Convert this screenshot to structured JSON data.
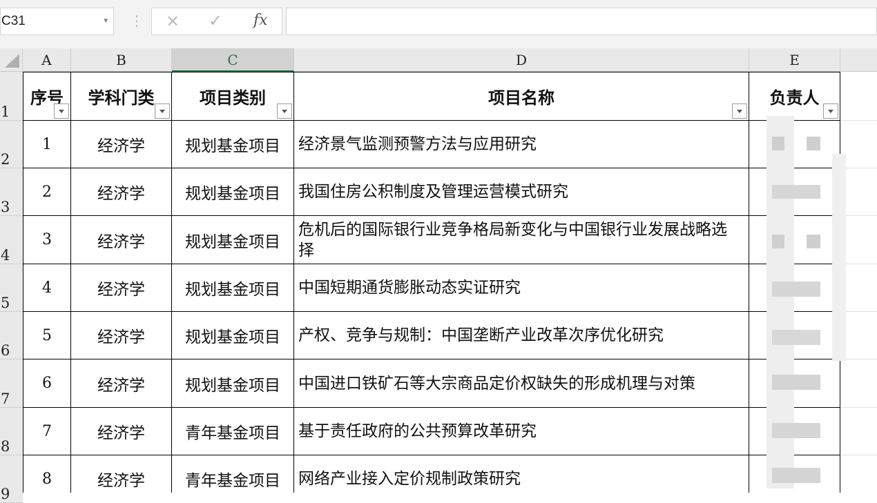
{
  "formula_bar": {
    "name_box": "C31",
    "cancel_icon": "×",
    "enter_icon": "✓",
    "fx_label": "fx",
    "formula": ""
  },
  "columns": [
    {
      "id": "A",
      "label": "A"
    },
    {
      "id": "B",
      "label": "B"
    },
    {
      "id": "C",
      "label": "C",
      "selected": true
    },
    {
      "id": "D",
      "label": "D"
    },
    {
      "id": "E",
      "label": "E"
    }
  ],
  "row_numbers": [
    "1",
    "2",
    "3",
    "4",
    "5",
    "6",
    "7",
    "8",
    "9"
  ],
  "table": {
    "headers": [
      "序号",
      "学科门类",
      "项目类别",
      "项目名称",
      "负责人"
    ],
    "rows": [
      {
        "no": "1",
        "subject": "经济学",
        "category": "规划基金项目",
        "name": "经济景气监测预警方法与应用研究"
      },
      {
        "no": "2",
        "subject": "经济学",
        "category": "规划基金项目",
        "name": "我国住房公积制度及管理运营模式研究"
      },
      {
        "no": "3",
        "subject": "经济学",
        "category": "规划基金项目",
        "name": "危机后的国际银行业竞争格局新变化与中国银行业发展战略选择"
      },
      {
        "no": "4",
        "subject": "经济学",
        "category": "规划基金项目",
        "name": "中国短期通货膨胀动态实证研究"
      },
      {
        "no": "5",
        "subject": "经济学",
        "category": "规划基金项目",
        "name": "产权、竞争与规制：中国垄断产业改革次序优化研究"
      },
      {
        "no": "6",
        "subject": "经济学",
        "category": "规划基金项目",
        "name": "中国进口铁矿石等大宗商品定价权缺失的形成机理与对策"
      },
      {
        "no": "7",
        "subject": "经济学",
        "category": "青年基金项目",
        "name": "基于责任政府的公共预算改革研究"
      },
      {
        "no": "8",
        "subject": "经济学",
        "category": "青年基金项目",
        "name": "网络产业接入定价规制政策研究"
      }
    ]
  },
  "colors": {
    "selected_col_accent": "#217346",
    "header_bg": "#e9e9e9",
    "toolbar_bg": "#f3f3f3"
  }
}
